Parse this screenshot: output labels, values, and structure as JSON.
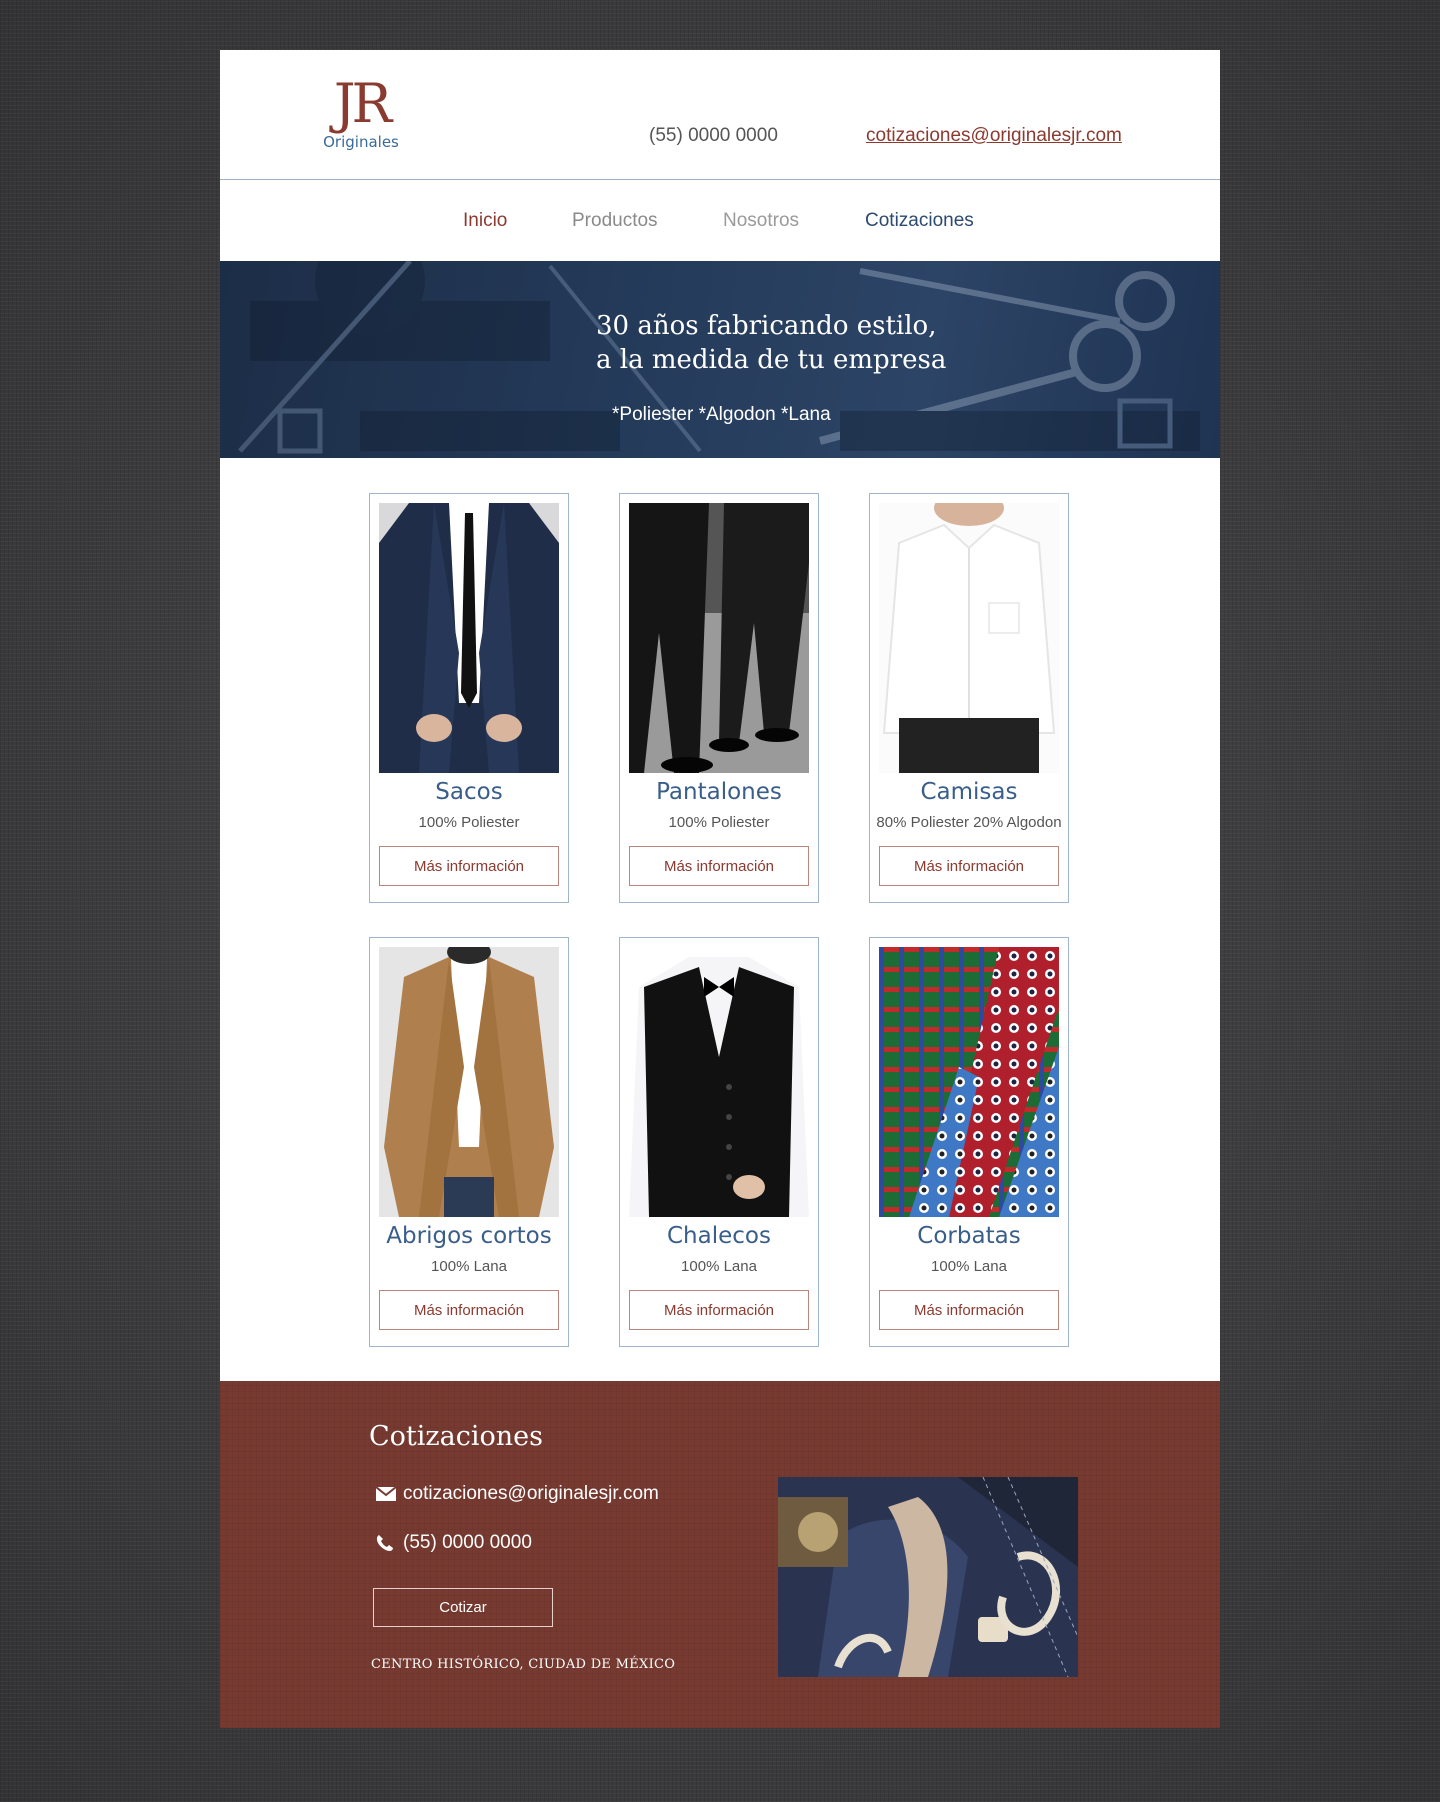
{
  "header": {
    "logo_mark": "JR",
    "logo_sub": "Originales",
    "phone": "(55) 0000 0000",
    "email": "cotizaciones@originalesjr.com"
  },
  "nav": {
    "items": [
      {
        "label": "Inicio"
      },
      {
        "label": "Productos"
      },
      {
        "label": "Nosotros"
      },
      {
        "label": "Cotizaciones"
      }
    ]
  },
  "hero": {
    "line1": "30 años fabricando estilo,",
    "line2": "a la medida de tu empresa",
    "subtitle": "*Poliester *Algodon *Lana"
  },
  "products": [
    {
      "name": "Sacos",
      "fabric": "100% Poliester",
      "button": "Más información"
    },
    {
      "name": "Pantalones",
      "fabric": "100% Poliester",
      "button": "Más información"
    },
    {
      "name": "Camisas",
      "fabric": "80% Poliester 20% Algodon",
      "button": "Más información"
    },
    {
      "name": "Abrigos cortos",
      "fabric": "100% Lana",
      "button": "Más información"
    },
    {
      "name": "Chalecos",
      "fabric": "100% Lana",
      "button": "Más información"
    },
    {
      "name": "Corbatas",
      "fabric": "100% Lana",
      "button": "Más información"
    }
  ],
  "footer": {
    "title": "Cotizaciones",
    "email": "cotizaciones@originalesjr.com",
    "phone": "(55) 0000 0000",
    "button": "Cotizar",
    "address": "CENTRO HISTÓRICO, CIUDAD DE MÉXICO",
    "email_icon": "envelope-icon",
    "phone_icon": "phone-icon"
  },
  "colors": {
    "brand_red": "#8b3a2f",
    "brand_blue": "#3a5e8a",
    "hero_bg": "#243a59",
    "footer_bg": "#773a31"
  }
}
